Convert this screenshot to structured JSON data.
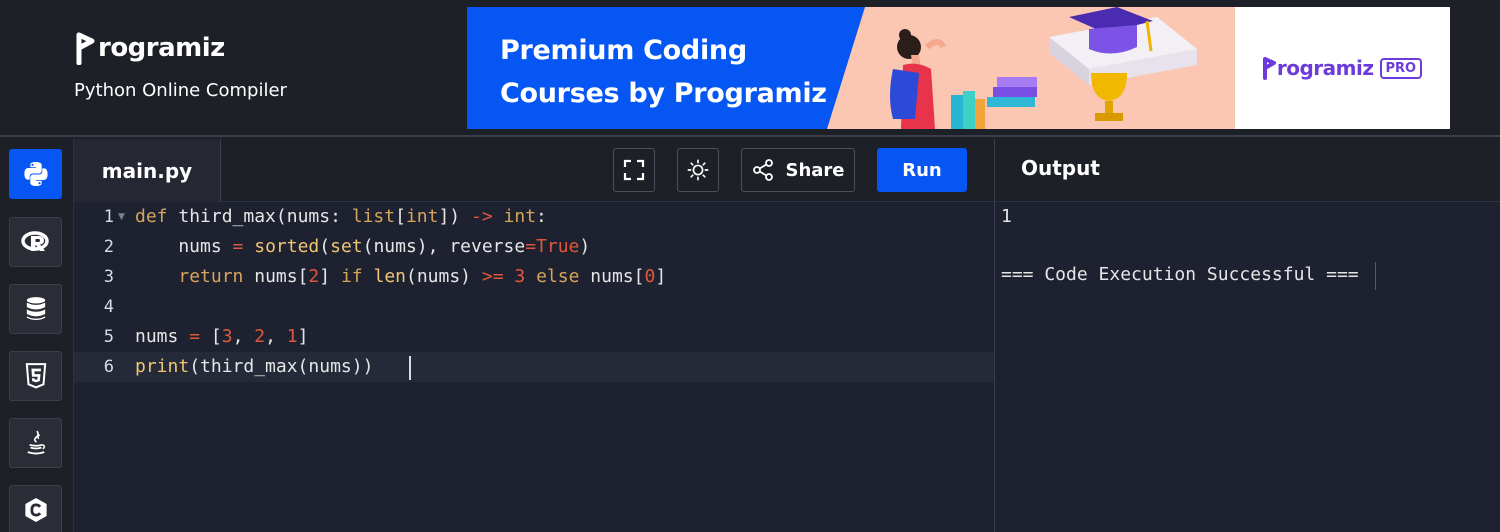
{
  "header": {
    "logo_text": "rogramiz",
    "subtitle": "Python Online Compiler"
  },
  "banner": {
    "line1": "Premium Coding",
    "line2": "Courses by Programiz",
    "pro_logo": "rogramiz",
    "pro_badge": "PRO"
  },
  "sidebar": {
    "items": [
      {
        "name": "python-icon",
        "active": true
      },
      {
        "name": "r-icon",
        "active": false
      },
      {
        "name": "database-icon",
        "active": false
      },
      {
        "name": "html5-icon",
        "active": false
      },
      {
        "name": "java-icon",
        "active": false
      },
      {
        "name": "c-icon",
        "active": false
      }
    ]
  },
  "editor": {
    "tab_label": "main.py",
    "share_label": "Share",
    "run_label": "Run",
    "line_numbers": [
      "1",
      "2",
      "3",
      "4",
      "5",
      "6"
    ]
  },
  "code_lines": [
    "def third_max(nums: list[int]) -> int:",
    "    nums = sorted(set(nums), reverse=True)",
    "    return nums[2] if len(nums) >= 3 else nums[0]",
    "",
    "nums = [3, 2, 1]",
    "print(third_max(nums))"
  ],
  "output": {
    "title": "Output",
    "lines": [
      "1",
      "",
      "=== Code Execution Successful ==="
    ]
  },
  "colors": {
    "accent": "#0556f3",
    "background": "#1d2027",
    "editor_bg": "#1e2230",
    "pro_purple": "#6d3bdc"
  }
}
